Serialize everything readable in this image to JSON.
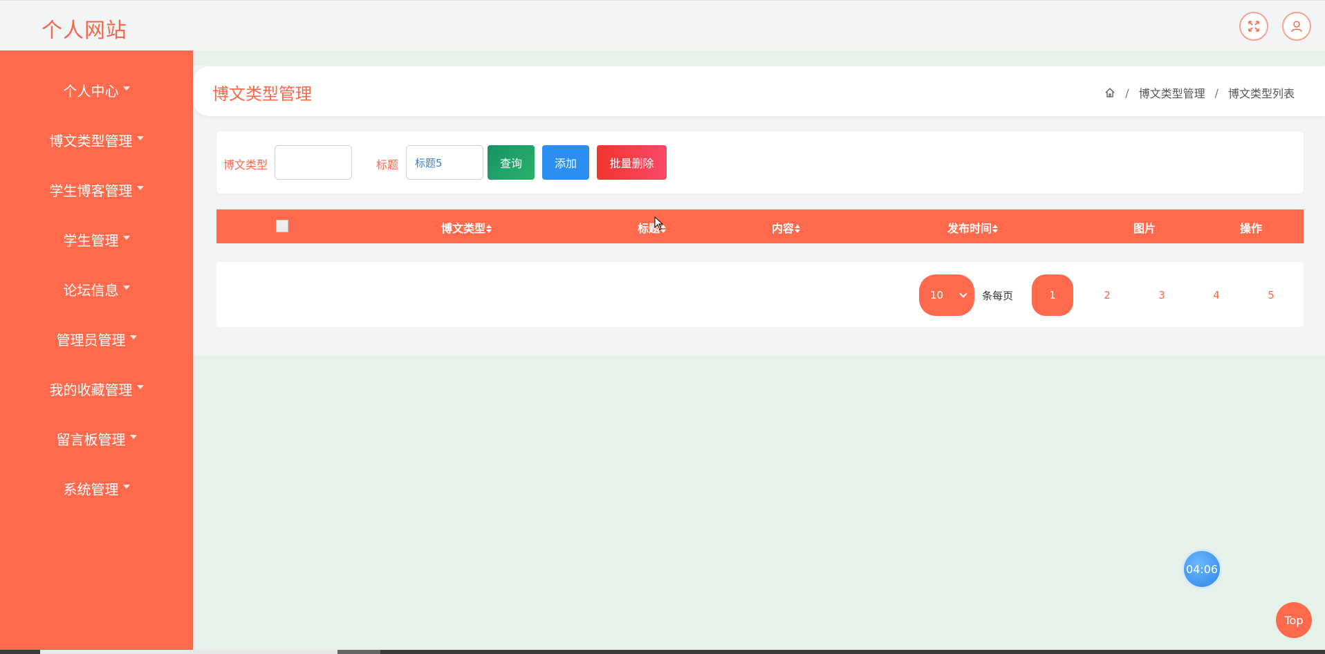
{
  "header": {
    "site_title": "个人网站",
    "fullscreen_icon": "expand-icon",
    "user_icon": "user-icon"
  },
  "sidebar": {
    "items": [
      {
        "label": "个人中心"
      },
      {
        "label": "博文类型管理"
      },
      {
        "label": "学生博客管理"
      },
      {
        "label": "学生管理"
      },
      {
        "label": "论坛信息"
      },
      {
        "label": "管理员管理"
      },
      {
        "label": "我的收藏管理"
      },
      {
        "label": "留言板管理"
      },
      {
        "label": "系统管理"
      }
    ]
  },
  "page": {
    "title": "博文类型管理",
    "breadcrumb": [
      "博文类型管理",
      "博文类型列表"
    ],
    "home_icon": "home-icon"
  },
  "search": {
    "type_label": "博文类型",
    "type_value": "",
    "title_label": "标题",
    "title_value": "标题5",
    "query_button": "查询",
    "add_button": "添加",
    "batch_delete_button": "批量删除"
  },
  "table": {
    "columns": [
      "博文类型",
      "标题",
      "内容",
      "发布时间",
      "图片",
      "操作"
    ]
  },
  "pagination": {
    "page_size": "10",
    "per_page_label": "条每页",
    "pages": [
      "1",
      "2",
      "3",
      "4",
      "5"
    ],
    "current_page": "1"
  },
  "floating": {
    "timer": "04:06",
    "top_button": "Top"
  },
  "colors": {
    "primary": "#fe6a4b",
    "title": "#f5684a",
    "query": "#169263",
    "add": "#2a8ff0",
    "delete": "#f2352e",
    "background": "#e6f1ea"
  }
}
